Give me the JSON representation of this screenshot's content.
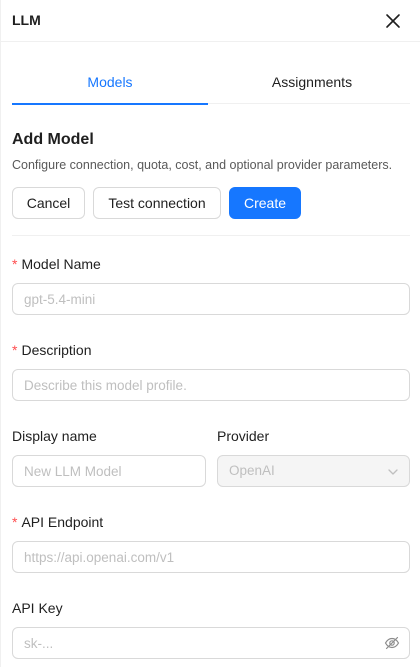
{
  "header": {
    "title": "LLM",
    "close_icon": "close-icon"
  },
  "tabs": [
    {
      "label": "Models",
      "active": true
    },
    {
      "label": "Assignments",
      "active": false
    }
  ],
  "section": {
    "title": "Add Model",
    "description": "Configure connection, quota, cost, and optional provider parameters."
  },
  "actions": {
    "cancel_label": "Cancel",
    "test_label": "Test connection",
    "create_label": "Create"
  },
  "form": {
    "model_name": {
      "label": "Model Name",
      "required": true,
      "placeholder": "gpt-5.4-mini",
      "value": ""
    },
    "description": {
      "label": "Description",
      "required": true,
      "placeholder": "Describe this model profile.",
      "value": ""
    },
    "display_name": {
      "label": "Display name",
      "required": false,
      "placeholder": "New LLM Model",
      "value": ""
    },
    "provider": {
      "label": "Provider",
      "value": "OpenAI",
      "disabled": true,
      "icon": "chevron-down-icon"
    },
    "api_endpoint": {
      "label": "API Endpoint",
      "required": true,
      "placeholder": "https://api.openai.com/v1",
      "value": ""
    },
    "api_key": {
      "label": "API Key",
      "required": false,
      "placeholder": "sk-...",
      "value": "",
      "toggle_icon": "eye-invisible-icon"
    }
  },
  "colors": {
    "primary": "#1677ff",
    "required": "#ff4d4f",
    "border": "#d9d9d9",
    "placeholder": "#bfbfbf",
    "divider": "#f0f0f0",
    "text": "#1f1f1f",
    "secondary_text": "#595959",
    "disabled_bg": "#f5f5f5"
  }
}
